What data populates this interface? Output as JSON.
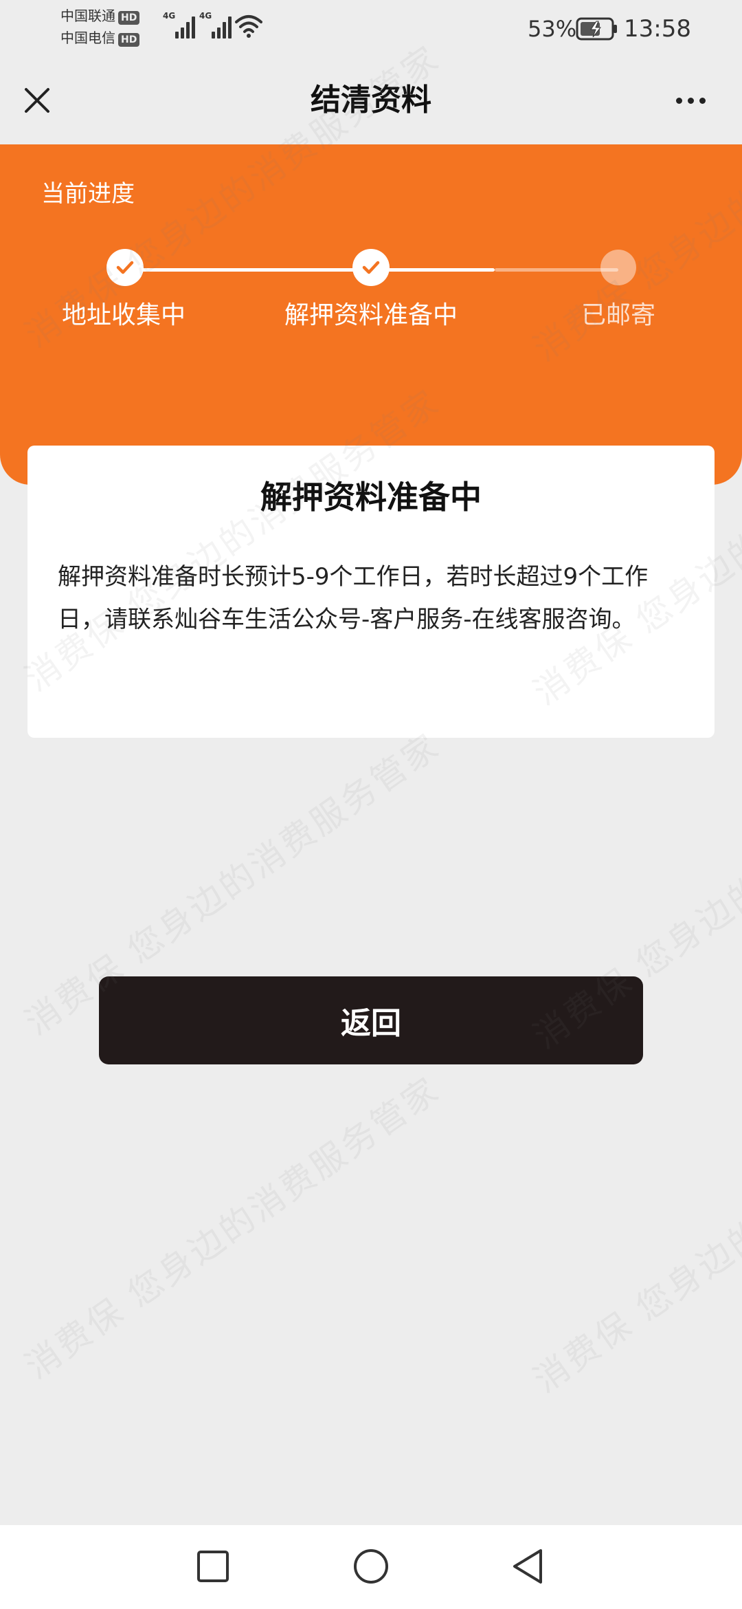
{
  "status_bar": {
    "carrier_1": "中国联通",
    "carrier_2": "中国电信",
    "hd_badge": "HD",
    "network_label": "4G",
    "battery_percent": "53%",
    "time": "13:58"
  },
  "nav": {
    "title": "结清资料"
  },
  "progress": {
    "title": "当前进度",
    "steps": [
      {
        "label": "地址收集中",
        "status": "done"
      },
      {
        "label": "解押资料准备中",
        "status": "done"
      },
      {
        "label": "已邮寄",
        "status": "pending"
      }
    ]
  },
  "card": {
    "title": "解押资料准备中",
    "body": "解押资料准备时长预计5-9个工作日，若时长超过9个工作日，请联系灿谷车生活公众号-客户服务-在线客服咨询。"
  },
  "back_button": {
    "label": "返回"
  },
  "watermark": {
    "text": "消费保 您身边的消费服务管家"
  },
  "colors": {
    "accent": "#f47421",
    "button_bg": "#221a1a",
    "page_bg": "#ededed"
  }
}
